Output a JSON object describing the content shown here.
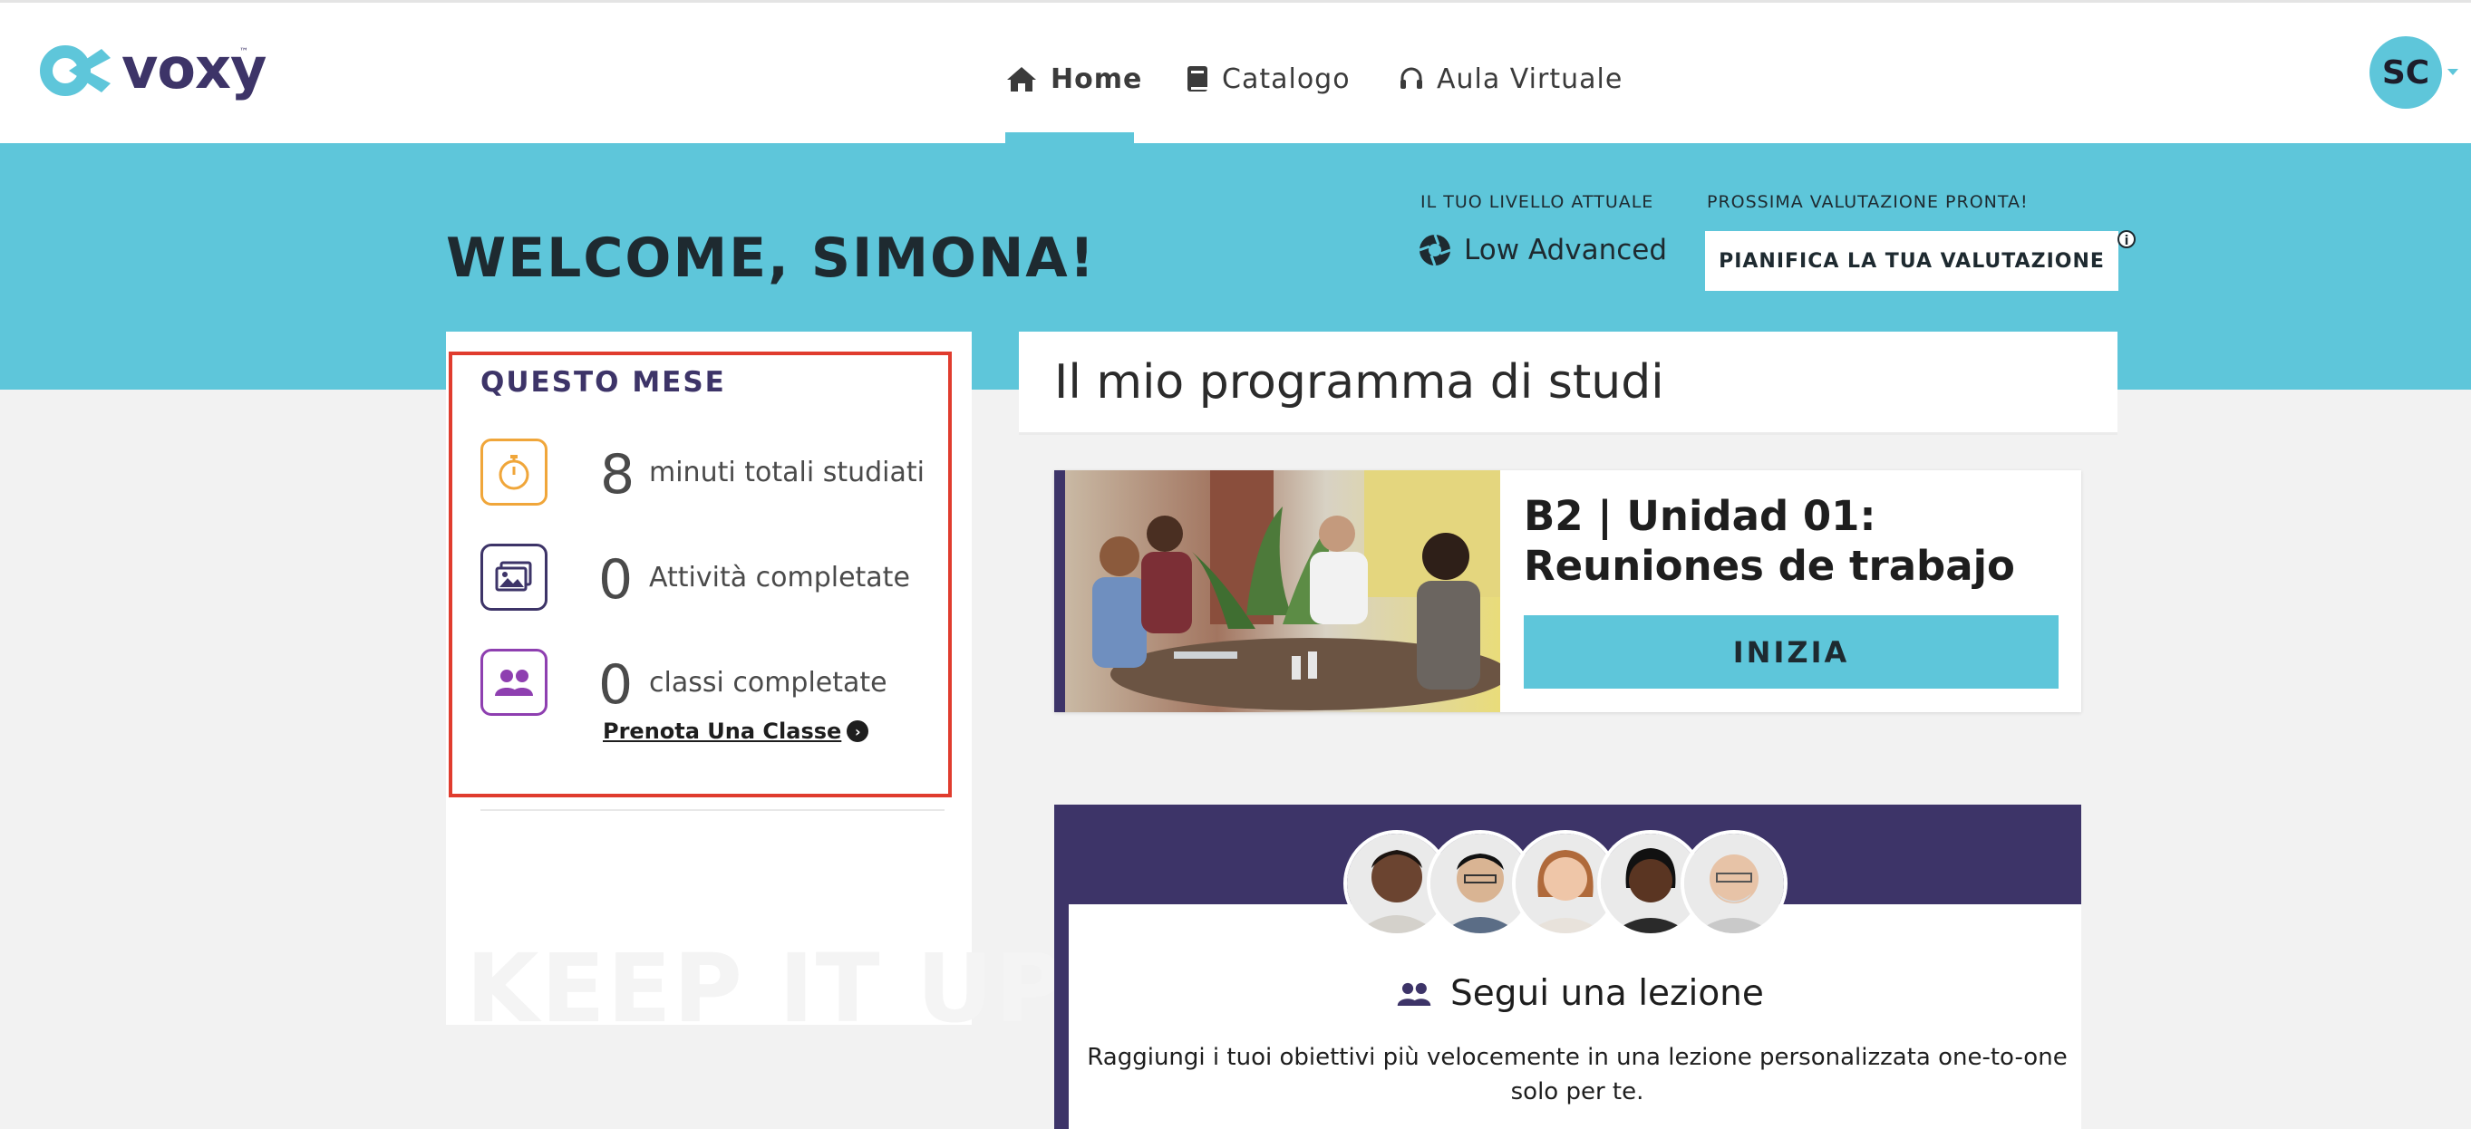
{
  "brand": {
    "name": "voxy",
    "trademark": "™"
  },
  "nav": {
    "items": [
      {
        "label": "Home",
        "icon": "home-icon",
        "active": true
      },
      {
        "label": "Catalogo",
        "icon": "book-icon",
        "active": false
      },
      {
        "label": "Aula Virtuale",
        "icon": "headset-icon",
        "active": false
      }
    ],
    "avatar_initials": "SC"
  },
  "hero": {
    "welcome": "WELCOME, SIMONA!",
    "level_label": "IL TUO LIVELLO ATTUALE",
    "level_value": "Low Advanced",
    "next_assessment_label": "PROSSIMA VALUTAZIONE PRONTA!",
    "plan_button": "PIANIFICA LA TUA VALUTAZIONE",
    "info_glyph": "i"
  },
  "stats": {
    "title": "QUESTO MESE",
    "items": [
      {
        "value": "8",
        "label": "minuti totali studiati",
        "icon": "stopwatch-icon",
        "color": "#f0a63a"
      },
      {
        "value": "0",
        "label": "Attività completate",
        "icon": "gallery-icon",
        "color": "#3d3468"
      },
      {
        "value": "0",
        "label": "classi completate",
        "icon": "users-icon",
        "color": "#8e3fb0"
      }
    ],
    "book_class_link": "Prenota Una Classe",
    "watermark": "KEEP IT UP!"
  },
  "program": {
    "title": "Il mio programma di studi",
    "unit_title": "B2 | Unidad 01: Reuniones de trabajo",
    "start_button": "INIZIA"
  },
  "lesson": {
    "title": "Segui una lezione",
    "description": "Raggiungi i tuoi obiettivi più velocemente in una lezione personalizzata one-to-one solo per te."
  },
  "colors": {
    "accent": "#5ec6da",
    "brand_purple": "#3d3468",
    "highlight_red": "#e03c2e"
  }
}
